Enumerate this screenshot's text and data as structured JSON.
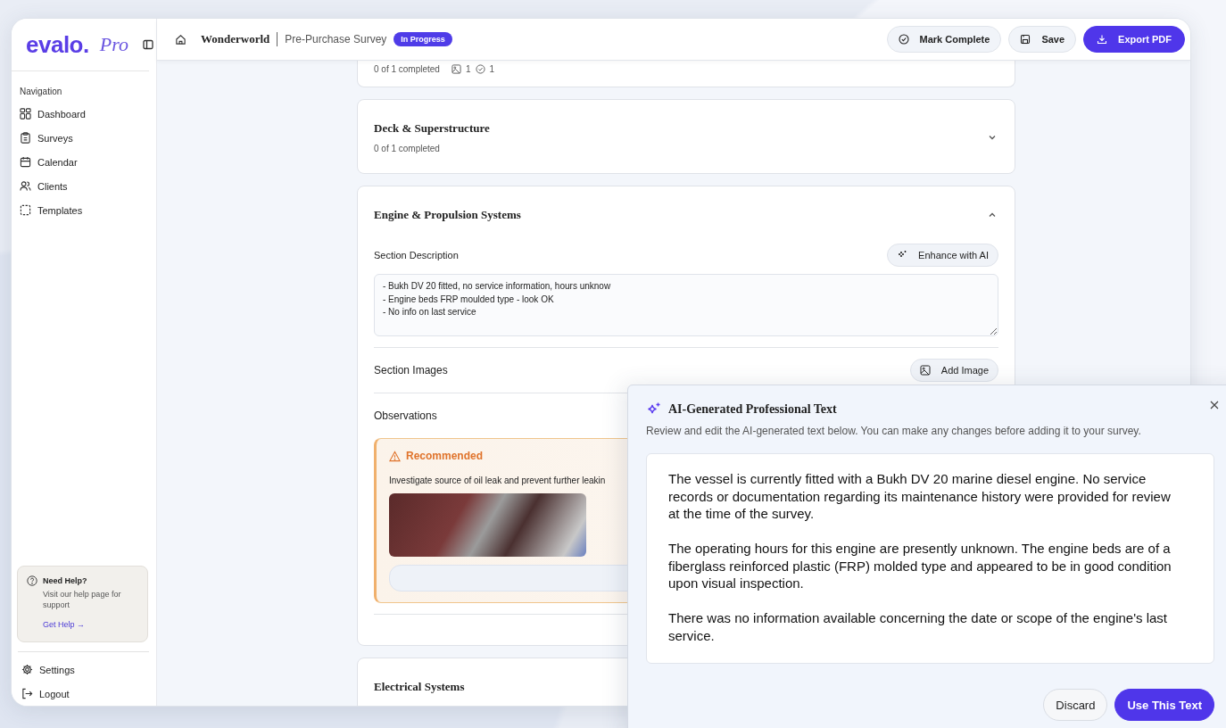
{
  "sidebar": {
    "logo": "evalo.",
    "logo_suffix": "Pro",
    "section_label": "Navigation",
    "items": [
      {
        "label": "Dashboard",
        "kind": "grid"
      },
      {
        "label": "Surveys",
        "kind": "clipboard"
      },
      {
        "label": "Calendar",
        "kind": "calendar"
      },
      {
        "label": "Clients",
        "kind": "users"
      },
      {
        "label": "Templates",
        "kind": "template"
      }
    ],
    "help": {
      "title": "Need Help?",
      "text": "Visit our help page for support",
      "link": "Get Help →"
    },
    "footer_items": [
      {
        "label": "Settings",
        "kind": "gear"
      },
      {
        "label": "Logout",
        "kind": "logout"
      }
    ]
  },
  "topbar": {
    "client": "Wonderworld",
    "survey": "Pre-Purchase Survey",
    "status": "In Progress",
    "buttons": [
      {
        "label": "Mark Complete",
        "kind": "check",
        "primary": false
      },
      {
        "label": "Save",
        "kind": "save",
        "primary": false
      },
      {
        "label": "Export PDF",
        "kind": "download",
        "primary": true
      }
    ]
  },
  "summary_card": {
    "progress": "0 of 1 completed",
    "images": "1",
    "checks": "1"
  },
  "sections": [
    {
      "title": "Deck & Superstructure",
      "progress": "0 of 1 completed",
      "expanded": false
    },
    {
      "title": "Engine & Propulsion Systems",
      "expanded": true,
      "body": {
        "description_label": "Section Description",
        "enhance_button": "Enhance with AI",
        "description": "- Bukh DV 20 fitted, no service information, hours unknow\n- Engine beds FRP moulded type - look OK\n- No info on last service",
        "images_label": "Section Images",
        "add_image_button": "Add Image",
        "observations_label": "Observations",
        "observation": {
          "severity": "Recommended",
          "text": "Investigate source of oil leak and prevent further leakin"
        }
      }
    },
    {
      "title": "Electrical Systems",
      "expanded": false
    }
  ],
  "dialog": {
    "title": "AI-Generated Professional Text",
    "subtitle": "Review and edit the AI-generated text below. You can make any changes before adding it to your survey.",
    "paragraphs": [
      "The vessel is currently fitted with a Bukh DV 20 marine diesel engine. No service records or documentation regarding its maintenance history were provided for review at the time of the survey.",
      "The operating hours for this engine are presently unknown. The engine beds are of a fiberglass reinforced plastic (FRP) molded type and appeared to be in good condition upon visual inspection.",
      "There was no information available concerning the date or scope of the engine's last service."
    ],
    "buttons": [
      {
        "label": "Discard",
        "primary": false
      },
      {
        "label": "Use This Text",
        "primary": true
      }
    ]
  }
}
